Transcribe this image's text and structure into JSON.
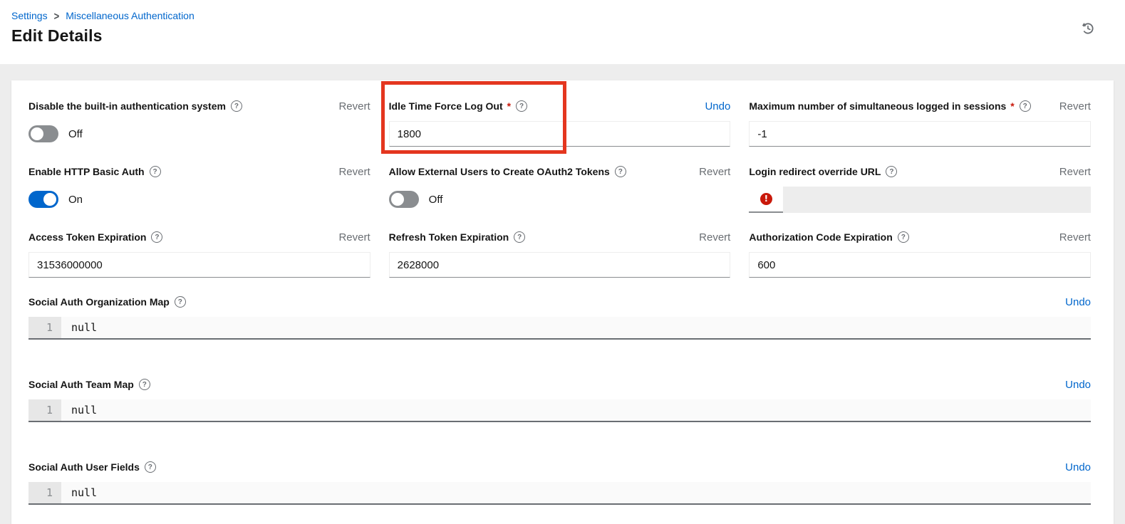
{
  "breadcrumb": {
    "items": [
      "Settings",
      "Miscellaneous Authentication"
    ],
    "divider": ">"
  },
  "page": {
    "title": "Edit Details"
  },
  "icons": {
    "history": "history-icon",
    "help": "?",
    "error": "!"
  },
  "colors": {
    "link_blue": "#0066cc",
    "toggle_on": "#0066cc",
    "toggle_off": "#8a8d90",
    "error_red": "#c9190b",
    "annotation_red": "#e4361f"
  },
  "form": {
    "required_marker": "*",
    "fields": {
      "disable_builtin_auth": {
        "label": "Disable the built-in authentication system",
        "action": "Revert",
        "value": "Off"
      },
      "idle_time_force_logout": {
        "label": "Idle Time Force Log Out",
        "required": "*",
        "action": "Undo",
        "value": "1800"
      },
      "max_sessions": {
        "label": "Maximum number of simultaneous logged in sessions",
        "required": "*",
        "action": "Revert",
        "value": "-1"
      },
      "enable_http_basic_auth": {
        "label": "Enable HTTP Basic Auth",
        "action": "Revert",
        "value": "On"
      },
      "allow_oauth2_tokens": {
        "label": "Allow External Users to Create OAuth2 Tokens",
        "action": "Revert",
        "value": "Off"
      },
      "login_redirect_url": {
        "label": "Login redirect override URL",
        "action": "Revert",
        "value": ""
      },
      "access_token_expiration": {
        "label": "Access Token Expiration",
        "action": "Revert",
        "value": "31536000000"
      },
      "refresh_token_expiration": {
        "label": "Refresh Token Expiration",
        "action": "Revert",
        "value": "2628000"
      },
      "auth_code_expiration": {
        "label": "Authorization Code Expiration",
        "action": "Revert",
        "value": "600"
      }
    },
    "editors": {
      "social_auth_org_map": {
        "label": "Social Auth Organization Map",
        "action": "Undo",
        "line_number": "1",
        "code": "null"
      },
      "social_auth_team_map": {
        "label": "Social Auth Team Map",
        "action": "Undo",
        "line_number": "1",
        "code": "null"
      },
      "social_auth_user_fields": {
        "label": "Social Auth User Fields",
        "action": "Undo",
        "line_number": "1",
        "code": "null"
      }
    }
  }
}
